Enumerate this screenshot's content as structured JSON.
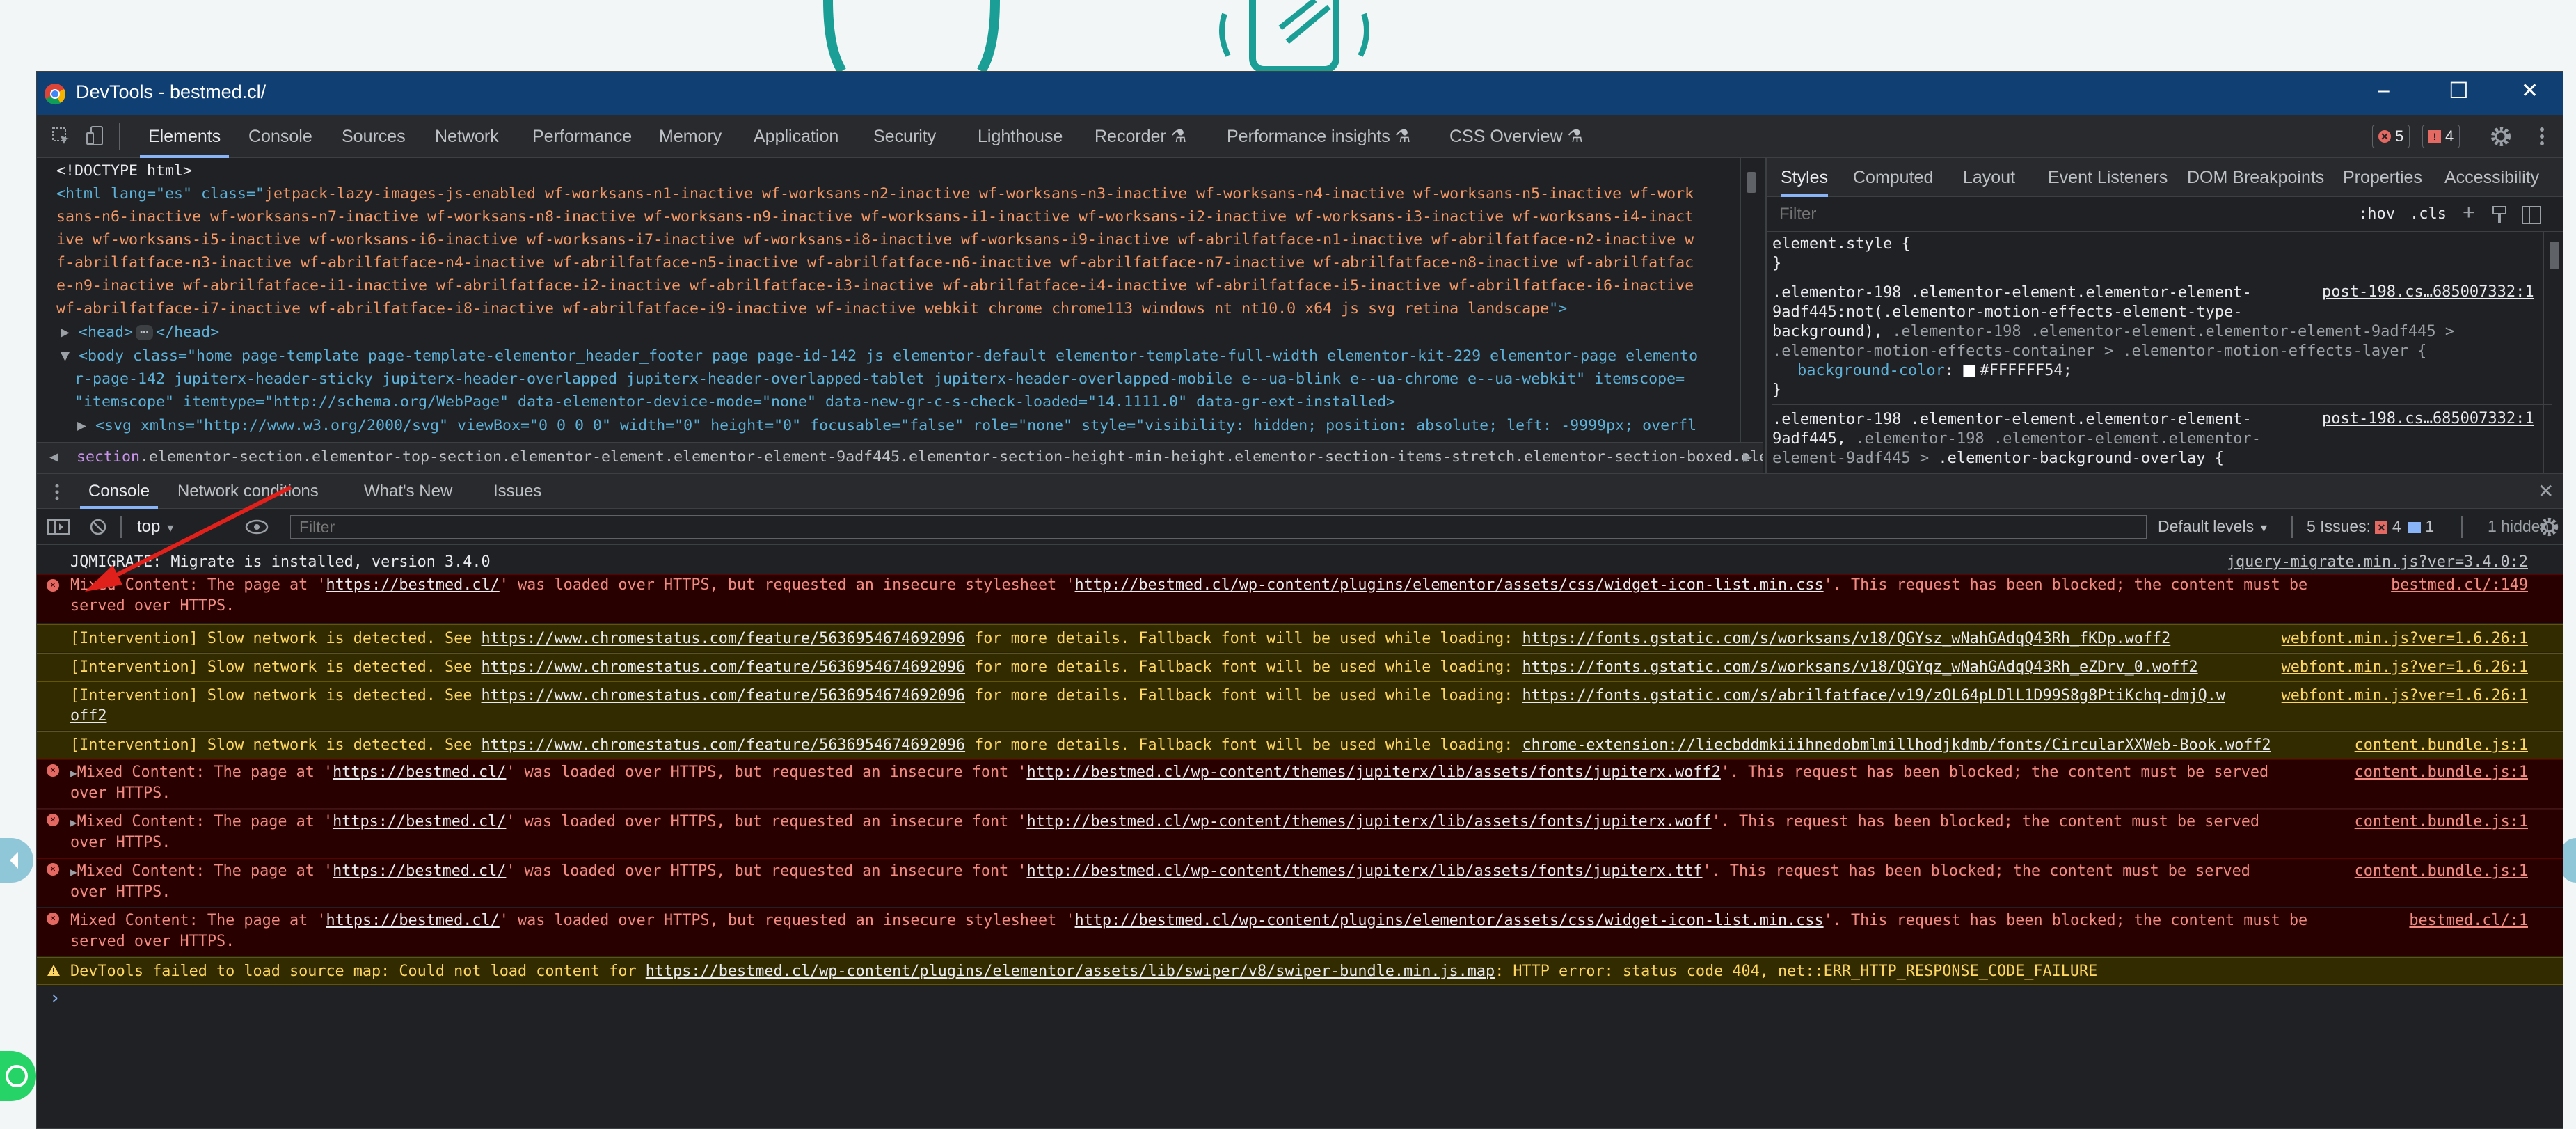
{
  "window": {
    "title": "DevTools - bestmed.cl/",
    "controls": {
      "minimize": "–",
      "maximize": "☐",
      "close": "✕"
    }
  },
  "main_tabs": [
    "Elements",
    "Console",
    "Sources",
    "Network",
    "Performance",
    "Memory",
    "Application",
    "Security",
    "Lighthouse",
    "Recorder ⚗",
    "Performance insights ⚗",
    "CSS Overview ⚗"
  ],
  "badges": {
    "errors": "5",
    "issues": "4"
  },
  "elements": {
    "doctype": "<!DOCTYPE html>",
    "html_lines": [
      "jetpack-lazy-images-js-enabled wf-worksans-n1-inactive wf-worksans-n2-inactive wf-worksans-n3-inactive wf-worksans-n4-inactive wf-worksans-n5-inactive wf-work",
      "sans-n6-inactive wf-worksans-n7-inactive wf-worksans-n8-inactive wf-worksans-n9-inactive wf-worksans-i1-inactive wf-worksans-i2-inactive wf-worksans-i3-inactive wf-worksans-i4-inact",
      "ive wf-worksans-i5-inactive wf-worksans-i6-inactive wf-worksans-i7-inactive wf-worksans-i8-inactive wf-worksans-i9-inactive wf-abrilfatface-n1-inactive wf-abrilfatface-n2-inactive w",
      "f-abrilfatface-n3-inactive wf-abrilfatface-n4-inactive wf-abrilfatface-n5-inactive wf-abrilfatface-n6-inactive wf-abrilfatface-n7-inactive wf-abrilfatface-n8-inactive wf-abrilfatfac",
      "e-n9-inactive wf-abrilfatface-i1-inactive wf-abrilfatface-i2-inactive wf-abrilfatface-i3-inactive wf-abrilfatface-i4-inactive wf-abrilfatface-i5-inactive wf-abrilfatface-i6-inactive",
      "wf-abrilfatface-i7-inactive wf-abrilfatface-i8-inactive wf-abrilfatface-i9-inactive wf-inactive webkit chrome chrome113 windows nt nt10.0 x64 js svg retina landscape"
    ],
    "html_open": "<html lang=\"es\" class=\"",
    "html_close": "\">",
    "head": "<head>",
    "head_ellipsis": "⋯",
    "head_close": "</head>",
    "body_lines": [
      "<body class=\"home page-template page-template-elementor_header_footer page page-id-142 js elementor-default elementor-template-full-width elementor-kit-229 elementor-page elemento",
      "r-page-142 jupiterx-header-sticky jupiterx-header-overlapped jupiterx-header-overlapped-tablet jupiterx-header-overlapped-mobile e--ua-blink e--ua-chrome e--ua-webkit\" itemscope=",
      "\"itemscope\" itemtype=\"http://schema.org/WebPage\" data-elementor-device-mode=\"none\" data-new-gr-c-s-check-loaded=\"14.1111.0\" data-gr-ext-installed>"
    ],
    "svg_line": "<svg xmlns=\"http://www.w3.org/2000/svg\" viewBox=\"0 0 0 0\" width=\"0\" height=\"0\" focusable=\"false\" role=\"none\" style=\"visibility: hidden; position: absolute; left: -9999px; overfl",
    "breadcrumb_tag": "section",
    "breadcrumb": ".elementor-section.elementor-top-section.elementor-element.elementor-element-9adf445.elementor-section-height-min-height.elementor-section-items-stretch.elementor-section-boxed.elementor-section-height-"
  },
  "styles": {
    "tabs": [
      "Styles",
      "Computed",
      "Layout",
      "Event Listeners",
      "DOM Breakpoints",
      "Properties",
      "Accessibility"
    ],
    "filter_placeholder": "Filter",
    "hov": ":hov",
    "cls": ".cls",
    "element_style": "element.style {",
    "close_brace": "}",
    "rule1": {
      "line1": ".elementor-198 .elementor-element.elementor-element-",
      "line2": "9adf445:not(.elementor-motion-effects-element-type-",
      "line3": "background), ",
      "line3_dim": ".elementor-198 .elementor-element.elementor-element-9adf445 >",
      "line4": ".elementor-motion-effects-container > .elementor-motion-effects-layer {",
      "prop": "background-color",
      "value": "#FFFFFF54",
      "swatch": "#FFFFFF",
      "source": "post-198.cs…685007332:1"
    },
    "rule2": {
      "line1": ".elementor-198 .elementor-element.elementor-element-",
      "line2": "9adf445, ",
      "line2_dim": ".elementor-198 .elementor-element.elementor-",
      "line3_dim": "element-9adf445 > ",
      "line3": ".elementor-background-overlay {",
      "source": "post-198.cs…685007332:1"
    }
  },
  "drawer_tabs": [
    "Console",
    "Network conditions",
    "What's New",
    "Issues"
  ],
  "console_toolbar": {
    "context": "top",
    "filter_placeholder": "Filter",
    "levels": "Default levels",
    "issues_label": "5 Issues:",
    "issues_errors": "4",
    "issues_info": "1",
    "hidden": "1 hidden"
  },
  "console": [
    {
      "level": "info",
      "text": "JQMIGRATE: Migrate is installed, version 3.4.0",
      "source": "jquery-migrate.min.js?ver=3.4.0:2"
    },
    {
      "level": "error",
      "arrow": "",
      "pre": "Mixed Content: The page at '",
      "url1": "https://bestmed.cl/",
      "mid": "' was loaded over HTTPS, but requested an insecure stylesheet '",
      "url2": "http://bestmed.cl/wp-content/plugins/elementor/assets/css/widget-icon-list.min.css",
      "post": "'. This request has been blocked; the content must be",
      "line2": "served over HTTPS.",
      "source": "bestmed.cl/:149"
    },
    {
      "level": "warn",
      "pre": "[Intervention] Slow network is detected. See ",
      "url1": "https://www.chromestatus.com/feature/5636954674692096",
      "mid": " for more details. Fallback font will be used while loading: ",
      "url2": "https://fonts.gstatic.com/s/worksans/v18/QGYsz_wNahGAdqQ43Rh_fKDp.woff2",
      "source": "webfont.min.js?ver=1.6.26:1"
    },
    {
      "level": "warn",
      "pre": "[Intervention] Slow network is detected. See ",
      "url1": "https://www.chromestatus.com/feature/5636954674692096",
      "mid": " for more details. Fallback font will be used while loading: ",
      "url2": "https://fonts.gstatic.com/s/worksans/v18/QGYqz_wNahGAdqQ43Rh_eZDrv_0.woff2",
      "source": "webfont.min.js?ver=1.6.26:1"
    },
    {
      "level": "warn",
      "pre": "[Intervention] Slow network is detected. See ",
      "url1": "https://www.chromestatus.com/feature/5636954674692096",
      "mid": " for more details. Fallback font will be used while loading: ",
      "url2": "https://fonts.gstatic.com/s/abrilfatface/v19/zOL64pLDlL1D99S8g8PtiKchq-dmjQ.w",
      "line2": "off2",
      "source": "webfont.min.js?ver=1.6.26:1"
    },
    {
      "level": "warn",
      "pre": "[Intervention] Slow network is detected. See ",
      "url1": "https://www.chromestatus.com/feature/5636954674692096",
      "mid": " for more details. Fallback font will be used while loading: ",
      "url2": "chrome-extension://liecbddmkiiihnedobmlmillhodjkdmb/fonts/CircularXXWeb-Book.woff2",
      "source": "content.bundle.js:1"
    },
    {
      "level": "error",
      "arrow": "▶",
      "pre": "Mixed Content: The page at '",
      "url1": "https://bestmed.cl/",
      "mid": "' was loaded over HTTPS, but requested an insecure font '",
      "url2": "http://bestmed.cl/wp-content/themes/jupiterx/lib/assets/fonts/jupiterx.woff2",
      "post": "'. This request has been blocked; the content must be served",
      "line2": "over HTTPS.",
      "source": "content.bundle.js:1"
    },
    {
      "level": "error",
      "arrow": "▶",
      "pre": "Mixed Content: The page at '",
      "url1": "https://bestmed.cl/",
      "mid": "' was loaded over HTTPS, but requested an insecure font '",
      "url2": "http://bestmed.cl/wp-content/themes/jupiterx/lib/assets/fonts/jupiterx.woff",
      "post": "'. This request has been blocked; the content must be served",
      "line2": "over HTTPS.",
      "source": "content.bundle.js:1"
    },
    {
      "level": "error",
      "arrow": "▶",
      "pre": "Mixed Content: The page at '",
      "url1": "https://bestmed.cl/",
      "mid": "' was loaded over HTTPS, but requested an insecure font '",
      "url2": "http://bestmed.cl/wp-content/themes/jupiterx/lib/assets/fonts/jupiterx.ttf",
      "post": "'. This request has been blocked; the content must be served",
      "line2": "over HTTPS.",
      "source": "content.bundle.js:1"
    },
    {
      "level": "error",
      "arrow": "",
      "pre": "Mixed Content: The page at '",
      "url1": "https://bestmed.cl/",
      "mid": "' was loaded over HTTPS, but requested an insecure stylesheet '",
      "url2": "http://bestmed.cl/wp-content/plugins/elementor/assets/css/widget-icon-list.min.css",
      "post": "'. This request has been blocked; the content must be",
      "line2": "served over HTTPS.",
      "source": "bestmed.cl/:1"
    },
    {
      "level": "warn",
      "pre": "DevTools failed to load source map: Could not load content for ",
      "url1": "https://bestmed.cl/wp-content/plugins/elementor/assets/lib/swiper/v8/swiper-bundle.min.js.map",
      "mid": ": HTTP error: status code 404, net::ERR_HTTP_RESPONSE_CODE_FAILURE",
      "source": ""
    }
  ],
  "prompt": "›",
  "colors": {
    "accent": "#8ab4f8",
    "error_bg": "#290000",
    "warn_bg": "#332b00",
    "titlebar": "#0f3f73",
    "annotation_arrow": "#e0201a",
    "teal": "#1a9e96",
    "whatsapp": "#25d366"
  }
}
